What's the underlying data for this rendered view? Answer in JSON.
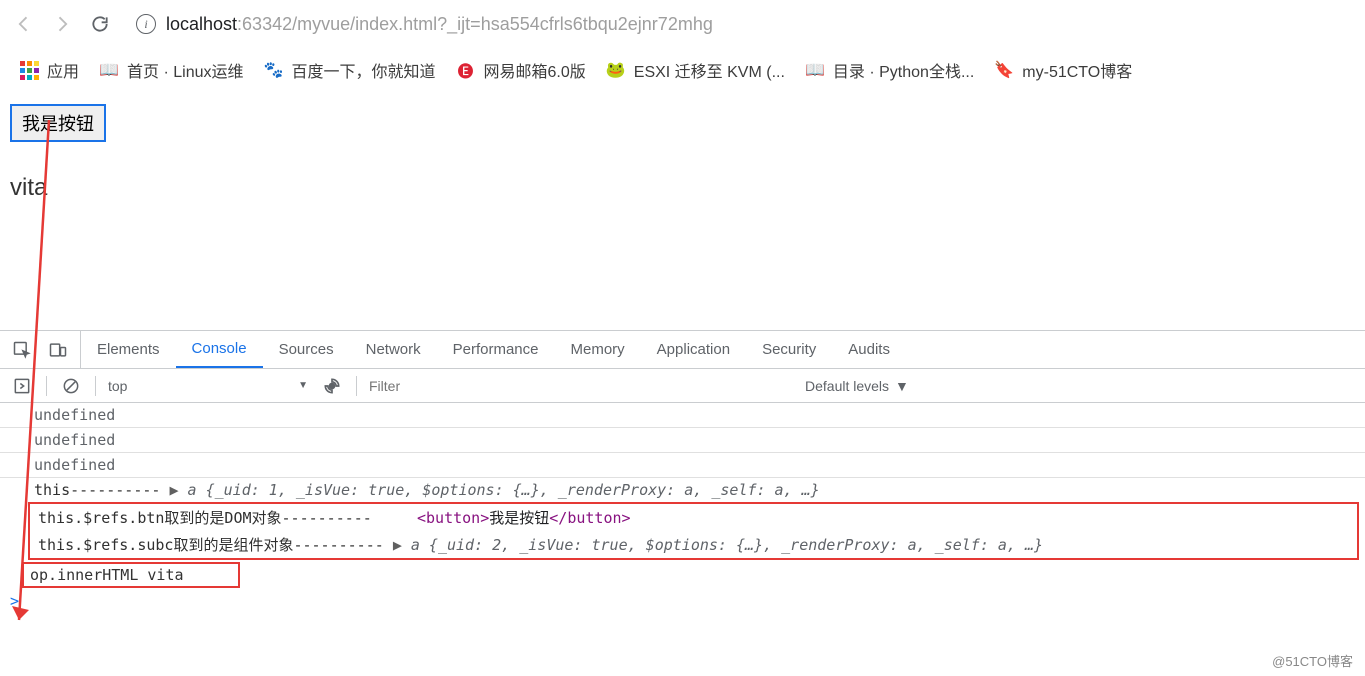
{
  "browser": {
    "url_host": "localhost",
    "url_rest": ":63342/myvue/index.html?_ijt=hsa554cfrls6tbqu2ejnr72mhg"
  },
  "bookmarks": {
    "apps": "应用",
    "items": [
      {
        "label": "首页 · Linux运维"
      },
      {
        "label": "百度一下，你就知道"
      },
      {
        "label": "网易邮箱6.0版"
      },
      {
        "label": "ESXI 迁移至 KVM (..."
      },
      {
        "label": "目录 · Python全栈..."
      },
      {
        "label": "my-51CTO博客"
      }
    ]
  },
  "page": {
    "button_label": "我是按钮",
    "text": "vita"
  },
  "devtools": {
    "tabs": [
      "Elements",
      "Console",
      "Sources",
      "Network",
      "Performance",
      "Memory",
      "Application",
      "Security",
      "Audits"
    ],
    "active_tab": "Console",
    "context": "top",
    "filter_placeholder": "Filter",
    "levels": "Default levels"
  },
  "console": {
    "l1": "undefined",
    "l2": "undefined",
    "l3": "undefined",
    "l4_label": "this----------",
    "l4_obj": "a {_uid: 1, _isVue: true, $options: {…}, _renderProxy: a, _self: a, …}",
    "l5_label": "this.$refs.btn取到的是DOM对象----------",
    "l5_tag_open": "<button>",
    "l5_tag_text": "我是按钮",
    "l5_tag_close": "</button>",
    "l6_label": "this.$refs.subc取到的是组件对象----------",
    "l6_obj": "a {_uid: 2, _isVue: true, $options: {…}, _renderProxy: a, _self: a, …}",
    "l7": "op.innerHTML vita",
    "prompt": ">"
  },
  "watermark": "@51CTO博客"
}
